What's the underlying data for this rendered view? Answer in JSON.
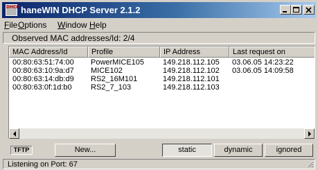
{
  "window": {
    "title": "haneWIN DHCP Server 2.1.2",
    "app_icon_text": "DHCP"
  },
  "menu": {
    "items": [
      {
        "key": "F",
        "rest": "ile"
      },
      {
        "key": "O",
        "rest": "ptions"
      },
      {
        "key": "W",
        "rest": "indow"
      },
      {
        "key": "H",
        "rest": "elp"
      }
    ]
  },
  "observed": {
    "text": "Observed MAC addresses/Id:  2/4"
  },
  "table": {
    "columns": [
      "MAC Address/Id",
      "Profile",
      "IP Address",
      "Last request on"
    ],
    "rows": [
      [
        "00:80:63:51:74:00",
        "PowerMICE105",
        "149.218.112.105",
        "03.06.05  14:23:22"
      ],
      [
        "00:80:63:10:9a:d7",
        "MICE102",
        "149.218.112.102",
        "03.06.05  14:09:58"
      ],
      [
        "00:80:63:14:db:d9",
        "RS2_16M101",
        "149.218.112.101",
        ""
      ],
      [
        "00:80:63:0f:1d:b0",
        "RS2_7_103",
        "149.218.112.103",
        ""
      ]
    ]
  },
  "bottom": {
    "tftp_label": "TFTP",
    "new_label": "New...",
    "static_label": "static",
    "dynamic_label": "dynamic",
    "ignored_label": "ignored"
  },
  "status": {
    "text": "Listening on Port: 67"
  }
}
